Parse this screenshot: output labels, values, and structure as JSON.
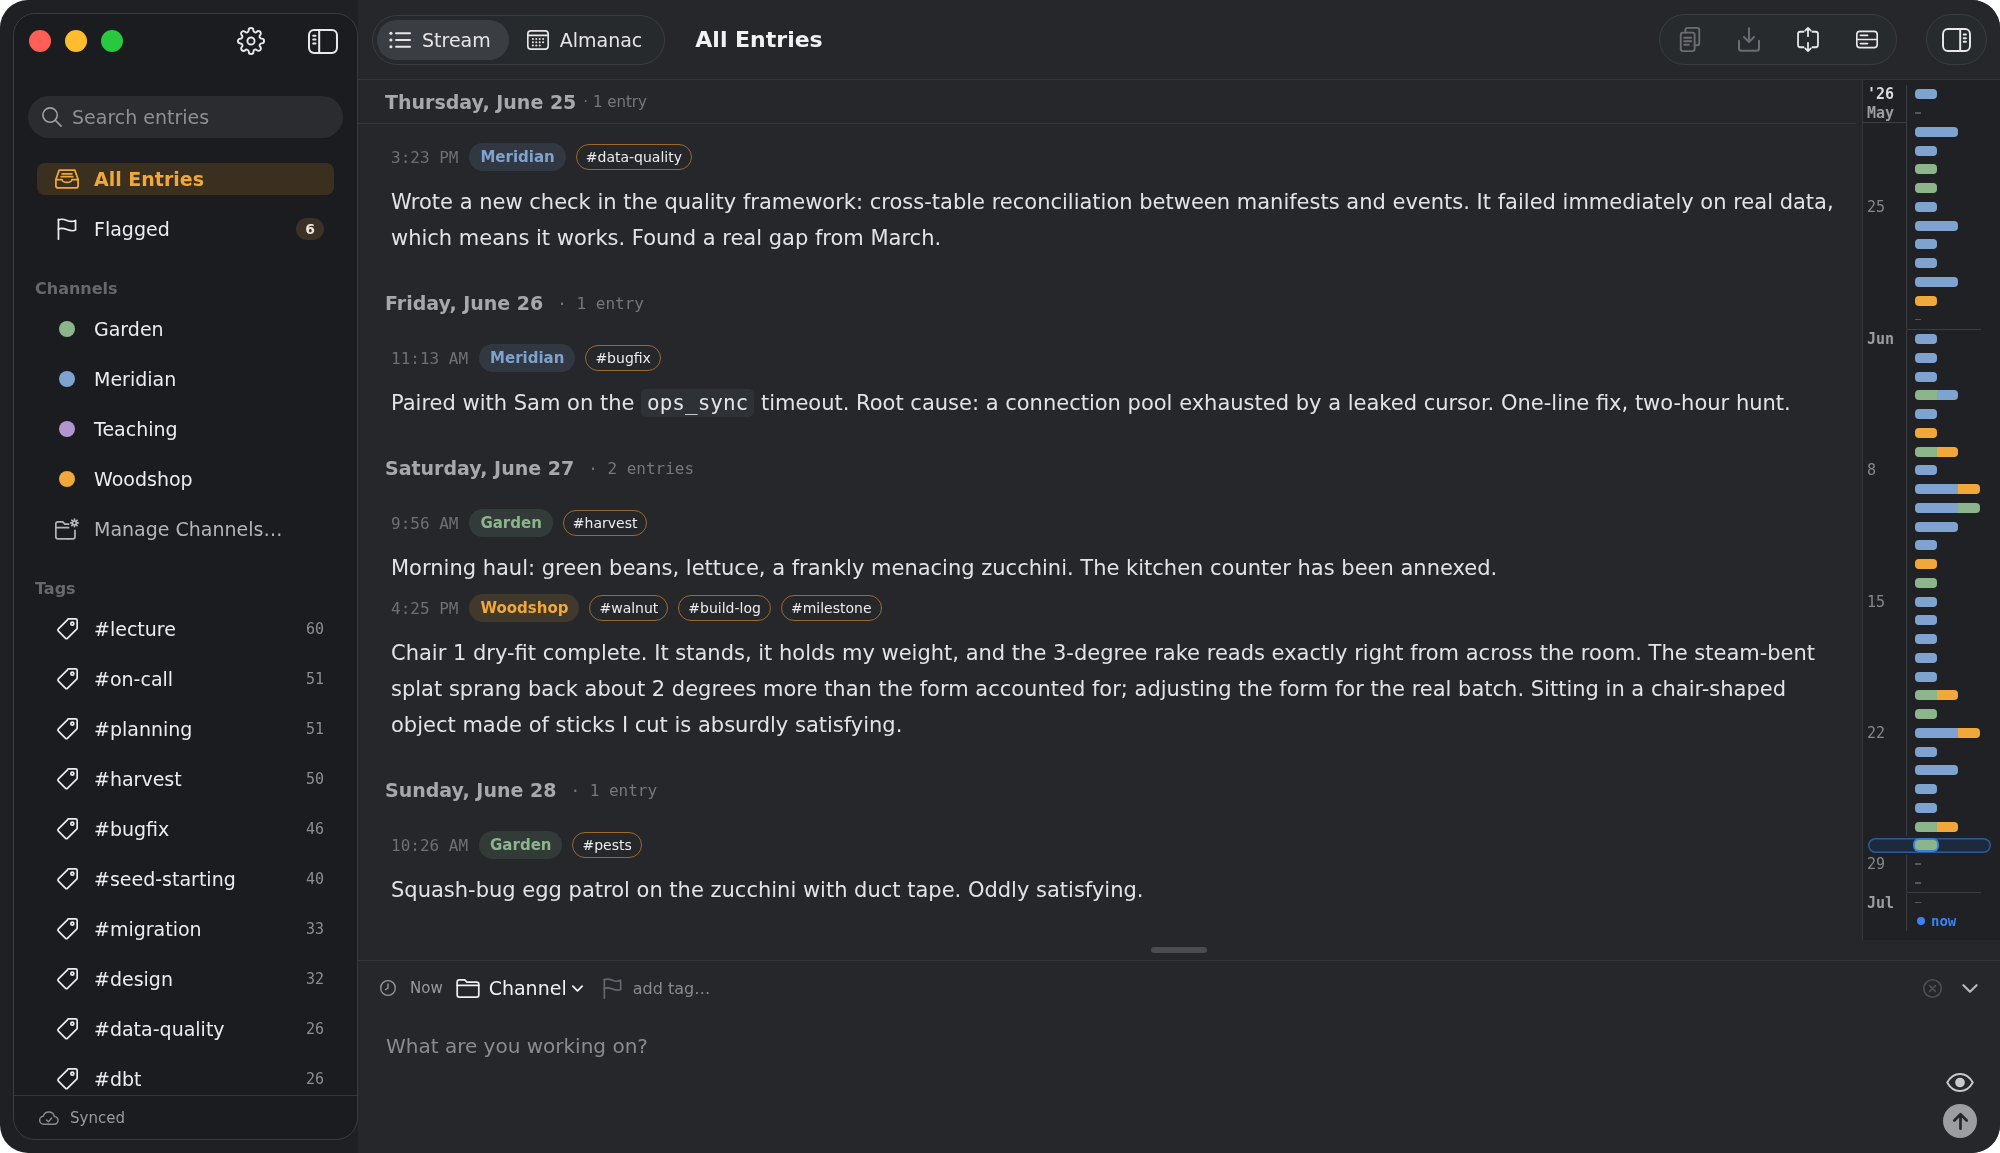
{
  "sidebar": {
    "search": {
      "placeholder": "Search entries"
    },
    "nav": [
      {
        "kind": "all",
        "label": "All Entries",
        "selected": true
      },
      {
        "kind": "flagged",
        "label": "Flagged",
        "count": "6",
        "selected": false
      }
    ],
    "channels_heading": "Channels",
    "channels": [
      {
        "name": "Garden",
        "color": "#8db58c",
        "selected": false
      },
      {
        "name": "Meridian",
        "color": "#7fa3d0",
        "selected": false
      },
      {
        "name": "Teaching",
        "color": "#b294cf",
        "selected": false
      },
      {
        "name": "Woodshop",
        "color": "#f0a83a",
        "selected": false
      }
    ],
    "manage_channels": "Manage Channels…",
    "tags_heading": "Tags",
    "tags": [
      {
        "name": "#lecture",
        "count": "60",
        "selected": false
      },
      {
        "name": "#on-call",
        "count": "51",
        "selected": false
      },
      {
        "name": "#planning",
        "count": "51",
        "selected": false
      },
      {
        "name": "#harvest",
        "count": "50",
        "selected": false
      },
      {
        "name": "#bugfix",
        "count": "46",
        "selected": false
      },
      {
        "name": "#seed-starting",
        "count": "40",
        "selected": false
      },
      {
        "name": "#migration",
        "count": "33",
        "selected": false
      },
      {
        "name": "#design",
        "count": "32",
        "selected": false
      },
      {
        "name": "#data-quality",
        "count": "26",
        "selected": false
      },
      {
        "name": "#dbt",
        "count": "26",
        "selected": false
      }
    ],
    "status": "Synced"
  },
  "toolbar": {
    "views": [
      {
        "kind": "list",
        "label": "Stream",
        "selected": true
      },
      {
        "kind": "calendar",
        "label": "Almanac",
        "selected": false
      }
    ],
    "title": "All Entries",
    "actions": [
      {
        "kind": "copy",
        "disabled": true
      },
      {
        "kind": "download",
        "disabled": true
      },
      {
        "kind": "expand",
        "disabled": false
      },
      {
        "kind": "rows",
        "disabled": false
      }
    ]
  },
  "stream": {
    "days": [
      {
        "date": "Thursday, June 25",
        "count": "· 1 entry",
        "pinned": true,
        "entries": [
          {
            "time": "3:23 PM",
            "channel": {
              "name": "Meridian",
              "color": "#7fa3d0"
            },
            "tags": [
              "#data-quality"
            ],
            "body": [
              {
                "kind": "text",
                "text": "Wrote a new check in the quality framework: cross-table reconciliation between manifests and events. It failed immediately on real data, which means it works. Found a real gap from March."
              }
            ]
          }
        ]
      },
      {
        "date": "Friday, June 26",
        "count": "· 1 entry",
        "pinned": false,
        "entries": [
          {
            "time": "11:13 AM",
            "channel": {
              "name": "Meridian",
              "color": "#7fa3d0"
            },
            "tags": [
              "#bugfix"
            ],
            "body": [
              {
                "kind": "text",
                "text": "Paired with Sam on the "
              },
              {
                "kind": "code",
                "text": "ops_sync"
              },
              {
                "kind": "text",
                "text": " timeout. Root cause: a connection pool exhausted by a leaked cursor. One-line fix, two-hour hunt."
              }
            ]
          }
        ]
      },
      {
        "date": "Saturday, June 27",
        "count": "· 2 entries",
        "pinned": false,
        "entries": [
          {
            "time": "9:56 AM",
            "channel": {
              "name": "Garden",
              "color": "#8db58c"
            },
            "tags": [
              "#harvest"
            ],
            "body": [
              {
                "kind": "text",
                "text": "Morning haul: green beans, lettuce, a frankly menacing zucchini. The kitchen counter has been annexed."
              }
            ]
          },
          {
            "time": "4:25 PM",
            "channel": {
              "name": "Woodshop",
              "color": "#f0a83a"
            },
            "tags": [
              "#walnut",
              "#build-log",
              "#milestone"
            ],
            "body": [
              {
                "kind": "text",
                "text": "Chair 1 dry-fit complete. It stands, it holds my weight, and the 3-degree rake reads exactly right from across the room. The steam-bent splat sprang back about 2 degrees more than the form accounted for; adjusting the form for the real batch. Sitting in a chair-shaped object made of sticks I cut is absurdly satisfying."
              }
            ]
          }
        ]
      },
      {
        "date": "Sunday, June 28",
        "count": "· 1 entry",
        "pinned": false,
        "entries": [
          {
            "time": "10:26 AM",
            "channel": {
              "name": "Garden",
              "color": "#8db58c"
            },
            "tags": [
              "#pests"
            ],
            "body": [
              {
                "kind": "text",
                "text": "Squash-bug egg patrol on the zucchini with duct tape. Oddly satisfying."
              }
            ]
          }
        ]
      }
    ]
  },
  "timeline": {
    "months": [
      {
        "days": [
          {
            "label": {
              "kind": "year",
              "text": "'26"
            },
            "selected": false,
            "entries": [
              {
                "color": "#7fa3d0"
              }
            ]
          },
          {
            "label": {
              "kind": "month",
              "text": "May"
            },
            "selected": false
          },
          {
            "selected": false,
            "entries": [
              {
                "color": "#7fa3d0"
              },
              {
                "color": "#7fa3d0"
              }
            ]
          },
          {
            "selected": false,
            "entries": [
              {
                "color": "#7fa3d0"
              }
            ]
          },
          {
            "selected": false,
            "entries": [
              {
                "color": "#8db58c"
              }
            ]
          },
          {
            "selected": false,
            "entries": [
              {
                "color": "#8db58c"
              }
            ]
          },
          {
            "label": {
              "kind": "day",
              "text": "25"
            },
            "selected": false,
            "entries": [
              {
                "color": "#7fa3d0"
              }
            ]
          },
          {
            "selected": false,
            "entries": [
              {
                "color": "#7fa3d0"
              },
              {
                "color": "#7fa3d0"
              }
            ]
          },
          {
            "selected": false,
            "entries": [
              {
                "color": "#7fa3d0"
              }
            ]
          },
          {
            "selected": false,
            "entries": [
              {
                "color": "#7fa3d0"
              }
            ]
          },
          {
            "selected": false,
            "entries": [
              {
                "color": "#7fa3d0"
              },
              {
                "color": "#7fa3d0"
              }
            ]
          },
          {
            "selected": false,
            "entries": [
              {
                "color": "#f0a83a"
              }
            ]
          },
          {
            "selected": false
          }
        ]
      },
      {
        "days": [
          {
            "label": {
              "kind": "month",
              "text": "Jun"
            },
            "selected": false,
            "entries": [
              {
                "color": "#7fa3d0"
              }
            ]
          },
          {
            "selected": false,
            "entries": [
              {
                "color": "#7fa3d0"
              }
            ]
          },
          {
            "selected": false,
            "entries": [
              {
                "color": "#7fa3d0"
              }
            ]
          },
          {
            "selected": false,
            "entries": [
              {
                "color": "#8db58c"
              },
              {
                "color": "#7fa3d0"
              }
            ]
          },
          {
            "selected": false,
            "entries": [
              {
                "color": "#7fa3d0"
              }
            ]
          },
          {
            "selected": false,
            "entries": [
              {
                "color": "#f0a83a"
              }
            ]
          },
          {
            "selected": false,
            "entries": [
              {
                "color": "#8db58c"
              },
              {
                "color": "#f0a83a"
              }
            ]
          },
          {
            "label": {
              "kind": "day",
              "text": "8"
            },
            "selected": false,
            "entries": [
              {
                "color": "#7fa3d0"
              }
            ]
          },
          {
            "selected": false,
            "entries": [
              {
                "color": "#7fa3d0"
              },
              {
                "color": "#7fa3d0"
              },
              {
                "color": "#f0a83a"
              }
            ]
          },
          {
            "selected": false,
            "entries": [
              {
                "color": "#7fa3d0"
              },
              {
                "color": "#7fa3d0"
              },
              {
                "color": "#8db58c"
              }
            ]
          },
          {
            "selected": false,
            "entries": [
              {
                "color": "#7fa3d0"
              },
              {
                "color": "#7fa3d0"
              }
            ]
          },
          {
            "selected": false,
            "entries": [
              {
                "color": "#7fa3d0"
              }
            ]
          },
          {
            "selected": false,
            "entries": [
              {
                "color": "#f0a83a"
              }
            ]
          },
          {
            "selected": false,
            "entries": [
              {
                "color": "#8db58c"
              }
            ]
          },
          {
            "label": {
              "kind": "day",
              "text": "15"
            },
            "selected": false,
            "entries": [
              {
                "color": "#7fa3d0"
              }
            ]
          },
          {
            "selected": false,
            "entries": [
              {
                "color": "#7fa3d0"
              }
            ]
          },
          {
            "selected": false,
            "entries": [
              {
                "color": "#7fa3d0"
              }
            ]
          },
          {
            "selected": false,
            "entries": [
              {
                "color": "#7fa3d0"
              }
            ]
          },
          {
            "selected": false,
            "entries": [
              {
                "color": "#7fa3d0"
              }
            ]
          },
          {
            "selected": false,
            "entries": [
              {
                "color": "#8db58c"
              },
              {
                "color": "#f0a83a"
              }
            ]
          },
          {
            "selected": false,
            "entries": [
              {
                "color": "#8db58c"
              }
            ]
          },
          {
            "label": {
              "kind": "day",
              "text": "22"
            },
            "selected": false,
            "entries": [
              {
                "color": "#7fa3d0"
              },
              {
                "color": "#7fa3d0"
              },
              {
                "color": "#f0a83a"
              }
            ]
          },
          {
            "selected": false,
            "entries": [
              {
                "color": "#7fa3d0"
              }
            ]
          },
          {
            "selected": false,
            "entries": [
              {
                "color": "#7fa3d0"
              },
              {
                "color": "#7fa3d0"
              }
            ]
          },
          {
            "selected": false,
            "entries": [
              {
                "color": "#7fa3d0"
              }
            ]
          },
          {
            "selected": false,
            "entries": [
              {
                "color": "#7fa3d0"
              }
            ]
          },
          {
            "selected": false,
            "entries": [
              {
                "color": "#8db58c"
              },
              {
                "color": "#f0a83a"
              }
            ]
          },
          {
            "selected": true,
            "entries": [
              {
                "color": "#8db58c"
              }
            ]
          },
          {
            "label": {
              "kind": "day",
              "text": "29"
            },
            "selected": false
          },
          {
            "selected": false
          }
        ]
      },
      {
        "days": [
          {
            "label": {
              "kind": "month",
              "text": "Jul"
            },
            "selected": false
          }
        ]
      }
    ],
    "now": "now"
  },
  "composer": {
    "time": "Now",
    "channel": "Channel",
    "flagged": false,
    "tag_field": {
      "placeholder": "add tag…"
    },
    "entry_field": {
      "placeholder": "What are you working on?"
    },
    "send": {
      "disabled": true
    }
  }
}
